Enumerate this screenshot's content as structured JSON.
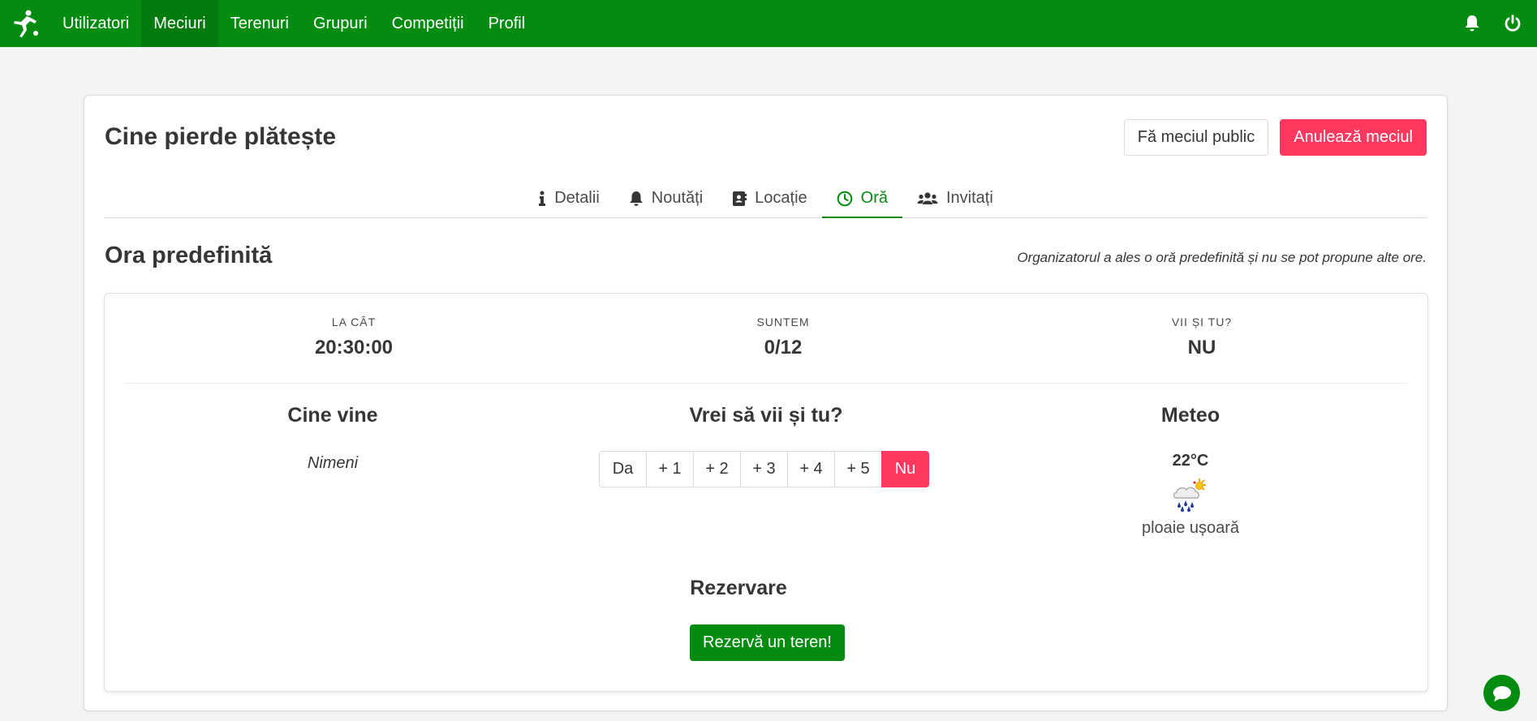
{
  "nav": {
    "items": [
      {
        "label": "Utilizatori"
      },
      {
        "label": "Meciuri"
      },
      {
        "label": "Terenuri"
      },
      {
        "label": "Grupuri"
      },
      {
        "label": "Competiții"
      },
      {
        "label": "Profil"
      }
    ],
    "active_item": "Meciuri",
    "icons": [
      "player-logo-icon",
      "bell-icon",
      "power-icon"
    ]
  },
  "match": {
    "title": "Cine pierde plătește",
    "make_public_label": "Fă meciul public",
    "cancel_label": "Anulează meciul"
  },
  "tabs": [
    {
      "label": "Detalii",
      "icon": "info-icon"
    },
    {
      "label": "Noutăți",
      "icon": "bell-icon"
    },
    {
      "label": "Locație",
      "icon": "address-book-icon"
    },
    {
      "label": "Oră",
      "icon": "clock-icon"
    },
    {
      "label": "Invitați",
      "icon": "users-icon"
    }
  ],
  "active_tab": "Oră",
  "time_section": {
    "title": "Ora predefinită",
    "note": "Organizatorul a ales o oră predefinită și nu se pot propune alte ore."
  },
  "stats": [
    {
      "heading": "LA CÂT",
      "value": "20:30:00"
    },
    {
      "heading": "SUNTEM",
      "value": "0/12"
    },
    {
      "heading": "VII ȘI TU?",
      "value": "NU"
    }
  ],
  "who_comes": {
    "title": "Cine vine",
    "empty_text": "Nimeni"
  },
  "attend": {
    "title": "Vrei să vii și tu?",
    "options": [
      "Da",
      "+ 1",
      "+ 2",
      "+ 3",
      "+ 4",
      "+ 5",
      "Nu"
    ],
    "selected": "Nu"
  },
  "weather": {
    "title": "Meteo",
    "temperature": "22°C",
    "description": "ploaie ușoară",
    "icon": "light-rain-sun-icon"
  },
  "reservation": {
    "title": "Rezervare",
    "button_label": "Rezervă un teren!"
  },
  "colors": {
    "brand": "#048c10",
    "danger": "#ff3860",
    "background": "#f3f4f4"
  }
}
